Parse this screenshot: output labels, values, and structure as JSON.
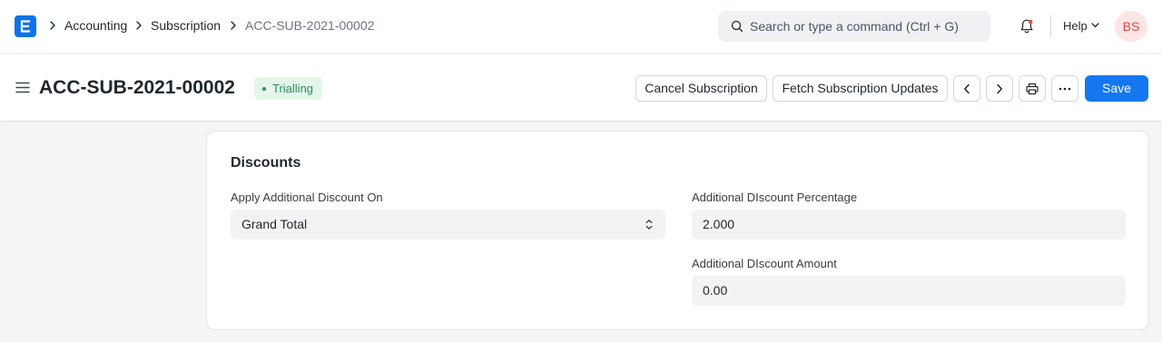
{
  "navbar": {
    "breadcrumbs": [
      "Accounting",
      "Subscription",
      "ACC-SUB-2021-00002"
    ],
    "search_placeholder": "Search or type a command (Ctrl + G)",
    "help_label": "Help",
    "avatar_initials": "BS",
    "logo_icon": "app-logo-icon"
  },
  "page": {
    "title": "ACC-SUB-2021-00002",
    "status": "Trialling",
    "status_color": "#278f5e",
    "buttons": {
      "cancel": "Cancel Subscription",
      "fetch": "Fetch Subscription Updates",
      "save": "Save"
    }
  },
  "form": {
    "section_title": "Discounts",
    "apply_discount_on_label": "Apply Additional Discount On",
    "apply_discount_on_value": "Grand Total",
    "discount_percentage_label": "Additional DIscount Percentage",
    "discount_percentage_value": "2.000",
    "discount_amount_label": "Additional DIscount Amount",
    "discount_amount_value": "0.00"
  },
  "colors": {
    "primary": "#1477f0",
    "status_bg": "#e4f5e9",
    "avatar_text": "#e0474a",
    "avatar_bg": "#fde5e5"
  }
}
